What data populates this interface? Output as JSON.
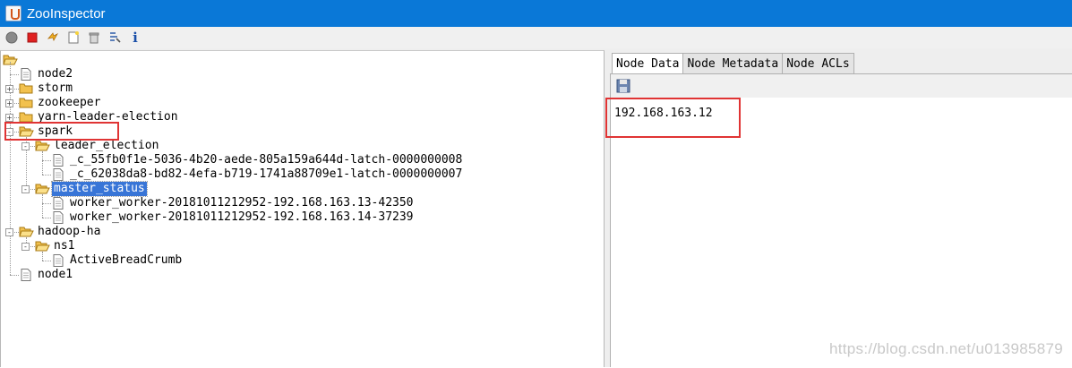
{
  "window": {
    "title": "ZooInspector"
  },
  "toolbar": {
    "buttons": [
      {
        "icon": "connect-icon"
      },
      {
        "icon": "disconnect-icon"
      },
      {
        "icon": "refresh-icon"
      },
      {
        "icon": "add-node-icon"
      },
      {
        "icon": "delete-node-icon"
      },
      {
        "icon": "node-viewers-icon"
      },
      {
        "icon": "about-icon"
      }
    ],
    "about_glyph": "i"
  },
  "tree": {
    "nodes": [
      {
        "label": "node2",
        "level": 1,
        "type": "file"
      },
      {
        "label": "storm",
        "level": 1,
        "type": "folder",
        "expander": "+"
      },
      {
        "label": "zookeeper",
        "level": 1,
        "type": "folder",
        "expander": "+"
      },
      {
        "label": "yarn-leader-election",
        "level": 1,
        "type": "folder",
        "expander": "+"
      },
      {
        "label": "spark",
        "level": 1,
        "type": "folder-open",
        "expander": "-"
      },
      {
        "label": "leader_election",
        "level": 2,
        "type": "folder-open",
        "expander": "-"
      },
      {
        "label": "_c_55fb0f1e-5036-4b20-aede-805a159a644d-latch-0000000008",
        "level": 3,
        "type": "file"
      },
      {
        "label": "_c_62038da8-bd82-4efa-b719-1741a88709e1-latch-0000000007",
        "level": 3,
        "type": "file"
      },
      {
        "label": "master_status",
        "level": 2,
        "type": "folder-open",
        "expander": "-",
        "selected": true
      },
      {
        "label": "worker_worker-20181011212952-192.168.163.13-42350",
        "level": 3,
        "type": "file"
      },
      {
        "label": "worker_worker-20181011212952-192.168.163.14-37239",
        "level": 3,
        "type": "file"
      },
      {
        "label": "hadoop-ha",
        "level": 1,
        "type": "folder-open",
        "expander": "-"
      },
      {
        "label": "ns1",
        "level": 2,
        "type": "folder-open",
        "expander": "-"
      },
      {
        "label": "ActiveBreadCrumb",
        "level": 3,
        "type": "file"
      },
      {
        "label": "node1",
        "level": 1,
        "type": "file"
      }
    ]
  },
  "tabs": [
    {
      "label": "Node Data",
      "active": true
    },
    {
      "label": "Node Metadata",
      "active": false
    },
    {
      "label": "Node ACLs",
      "active": false
    }
  ],
  "node_data": {
    "value": "192.168.163.12"
  },
  "watermark": "https://blog.csdn.net/u013985879",
  "colors": {
    "titlebar": "#0a78d7",
    "selection": "#3875d7",
    "highlight_box": "#e03434"
  }
}
